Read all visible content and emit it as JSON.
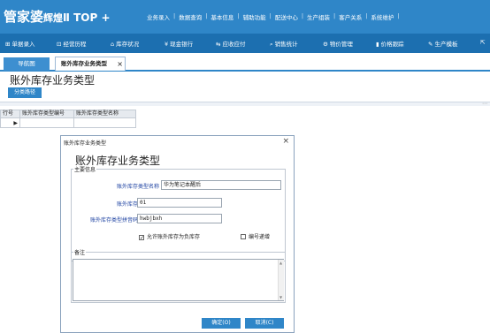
{
  "header": {
    "logo_main": "管家婆",
    "logo_sub": "辉煌",
    "logo_version": "Ⅱ TOP +",
    "menu": [
      "业务录入",
      "数据查询",
      "基本信息",
      "辅助功能",
      "配送中心",
      "生产组装",
      "客户关系",
      "系统维护"
    ]
  },
  "navbar": {
    "items": [
      {
        "icon": "⊞",
        "label": "单据录入"
      },
      {
        "icon": "⊡",
        "label": "经营历程"
      },
      {
        "icon": "⌂",
        "label": "库存状况"
      },
      {
        "icon": "¥",
        "label": "现金银行"
      },
      {
        "icon": "⇆",
        "label": "应收应付"
      },
      {
        "icon": "⌕",
        "label": "销售统计"
      },
      {
        "icon": "⚙",
        "label": "物价管理"
      },
      {
        "icon": "▮",
        "label": "价格跟踪"
      },
      {
        "icon": "✎",
        "label": "生产模板"
      },
      {
        "icon": "⇱",
        "label": ""
      }
    ]
  },
  "tabs": {
    "home": "导航图",
    "active": "账外库存业务类型",
    "close": "×"
  },
  "page": {
    "title": "账外库存业务类型",
    "path_button": "分类路径",
    "grip": "⋯"
  },
  "grid": {
    "headers": [
      "行号",
      "账外库存类型编号",
      "账外库存类型名称"
    ],
    "row_marker": "▶"
  },
  "dialog": {
    "title": "账外库存业务类型",
    "close": "×",
    "heading": "账外库存业务类型",
    "section_main": "主要信息",
    "fields": {
      "name_label": "账外库存类型名称",
      "name_value": "华为笔记本醒后",
      "code_label": "账外库存类型编号",
      "code_value": "01",
      "pinyin_label": "账外库存类型拼音码",
      "pinyin_value": "hwbjbxh"
    },
    "checkbox_allow_negative": {
      "label": "允许账外库存为负库存",
      "checked": true
    },
    "checkbox_code_increment": {
      "label": "编号递增",
      "checked": false
    },
    "section_note": "备注",
    "note_value": "",
    "ok_button": "确定(O)",
    "cancel_button": "取消(C)"
  }
}
